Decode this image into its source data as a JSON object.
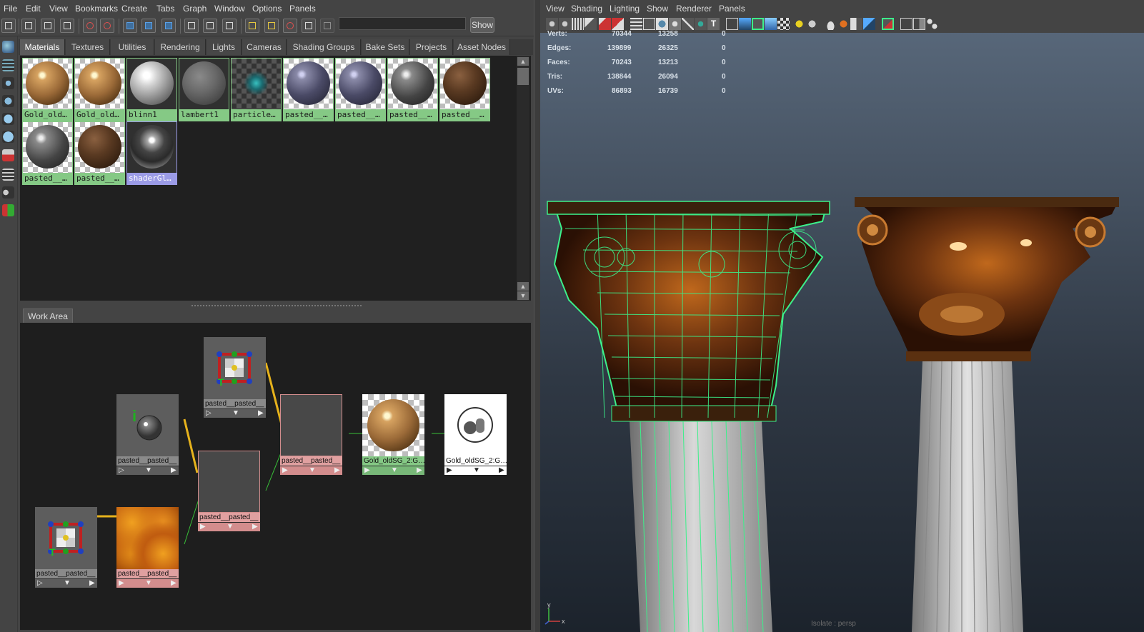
{
  "menubar": [
    "File",
    "Edit",
    "View",
    "Bookmarks",
    "Create",
    "Tabs",
    "Graph",
    "Window",
    "Options",
    "Panels"
  ],
  "toolbar": {
    "show_label": "Show",
    "search_value": ""
  },
  "tabs": [
    {
      "label": "Materials",
      "active": true
    },
    {
      "label": "Textures"
    },
    {
      "label": "Utilities"
    },
    {
      "label": "Rendering"
    },
    {
      "label": "Lights"
    },
    {
      "label": "Cameras"
    },
    {
      "label": "Shading Groups"
    },
    {
      "label": "Bake Sets"
    },
    {
      "label": "Projects"
    },
    {
      "label": "Asset Nodes"
    }
  ],
  "materials": [
    {
      "label": "Gold_old…",
      "kind": "gold"
    },
    {
      "label": "Gold_old…",
      "kind": "gold"
    },
    {
      "label": "blinn1",
      "kind": "white"
    },
    {
      "label": "lambert1",
      "kind": "gray"
    },
    {
      "label": "particle…",
      "kind": "particle"
    },
    {
      "label": "pasted__…",
      "kind": "rock-purple"
    },
    {
      "label": "pasted__…",
      "kind": "rock-purple"
    },
    {
      "label": "pasted__…",
      "kind": "rock-gray"
    },
    {
      "label": "pasted__…",
      "kind": "bronze"
    },
    {
      "label": "pasted__…",
      "kind": "rock-gray"
    },
    {
      "label": "pasted__…",
      "kind": "bronze"
    },
    {
      "label": "shaderGl…",
      "kind": "glass",
      "selected": true
    }
  ],
  "workarea": {
    "tab_label": "Work Area",
    "nodes": [
      {
        "id": "place2d-top",
        "label": "pasted__pasted__",
        "color": "gray",
        "kind": "place2d"
      },
      {
        "id": "info",
        "label": "pasted__pasted__",
        "color": "gray",
        "kind": "sampler"
      },
      {
        "id": "pink-mid",
        "label": "pasted__pasted__",
        "color": "pink",
        "kind": "empty"
      },
      {
        "id": "pink-right",
        "label": "pasted__pasted__",
        "color": "pink",
        "kind": "empty"
      },
      {
        "id": "gold-sg",
        "label": "Gold_oldSG_2:G…",
        "color": "green",
        "kind": "gold"
      },
      {
        "id": "sg",
        "label": "Gold_oldSG_2:G…",
        "color": "white",
        "kind": "sg"
      },
      {
        "id": "place2d-bottom",
        "label": "pasted__pasted__",
        "color": "gray",
        "kind": "place2d"
      },
      {
        "id": "texture",
        "label": "pasted__pasted__",
        "color": "pink",
        "kind": "texture"
      }
    ]
  },
  "viewport": {
    "menubar": [
      "View",
      "Shading",
      "Lighting",
      "Show",
      "Renderer",
      "Panels"
    ],
    "hud": [
      {
        "label": "Verts:",
        "a": "70344",
        "b": "13258",
        "c": "0"
      },
      {
        "label": "Edges:",
        "a": "139899",
        "b": "26325",
        "c": "0"
      },
      {
        "label": "Faces:",
        "a": "70243",
        "b": "13213",
        "c": "0"
      },
      {
        "label": "Tris:",
        "a": "138844",
        "b": "26094",
        "c": "0"
      },
      {
        "label": "UVs:",
        "a": "86893",
        "b": "16739",
        "c": "0"
      }
    ],
    "isolate_text": "Isolate : persp",
    "axis": {
      "x": "x",
      "y": "y"
    }
  },
  "colors": {
    "accent_green": "#85c985",
    "accent_pink": "#e0a0a0",
    "select_purple": "#9b9be6",
    "wire_green": "#3cf08a"
  }
}
